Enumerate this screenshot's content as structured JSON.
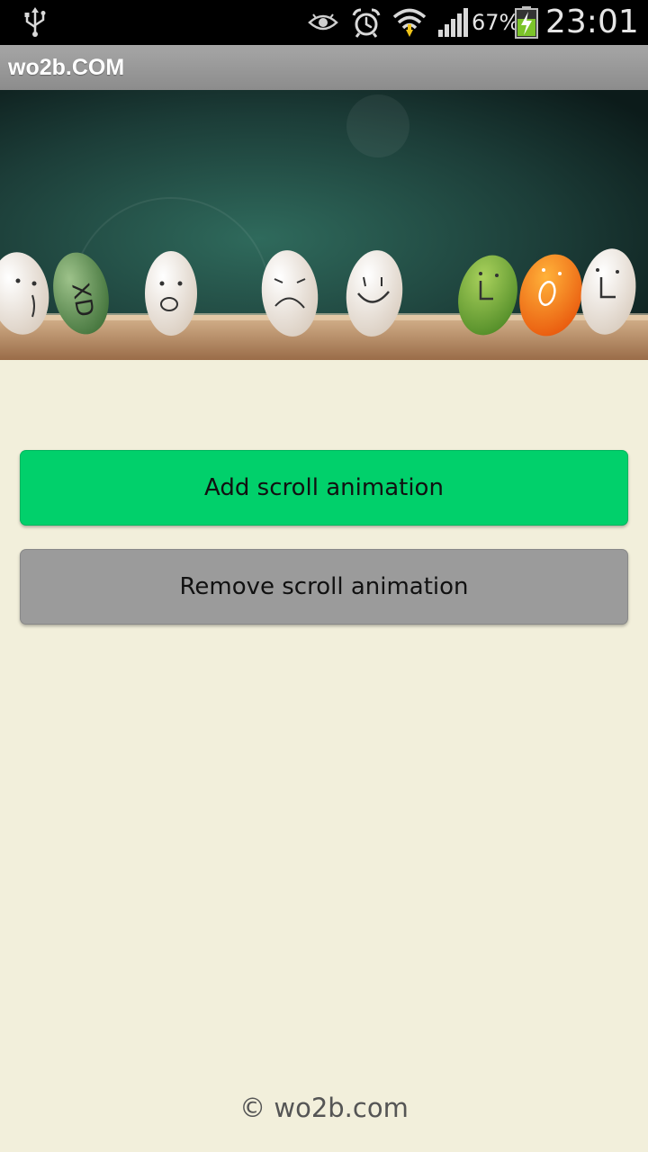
{
  "status_bar": {
    "icons": [
      "usb-icon",
      "eye-icon",
      "alarm-icon",
      "wifi-icon",
      "signal-icon",
      "battery-charging-icon"
    ],
    "battery_percent": "67%",
    "time": "23:01"
  },
  "app": {
    "title": "wo2b.COM"
  },
  "banner": {
    "description_icon": "pills-with-faces-image",
    "pill_faces": [
      "XD",
      "o",
      "L",
      "O",
      "L"
    ]
  },
  "buttons": {
    "add_label": "Add scroll animation",
    "remove_label": "Remove scroll animation"
  },
  "footer": {
    "copyright": "© wo2b.com"
  },
  "colors": {
    "status_bar": "#000000",
    "title_bar": "#9a9a9a",
    "background": "#f2efdb",
    "add_button": "#01d06b",
    "remove_button": "#9b9b9b"
  }
}
